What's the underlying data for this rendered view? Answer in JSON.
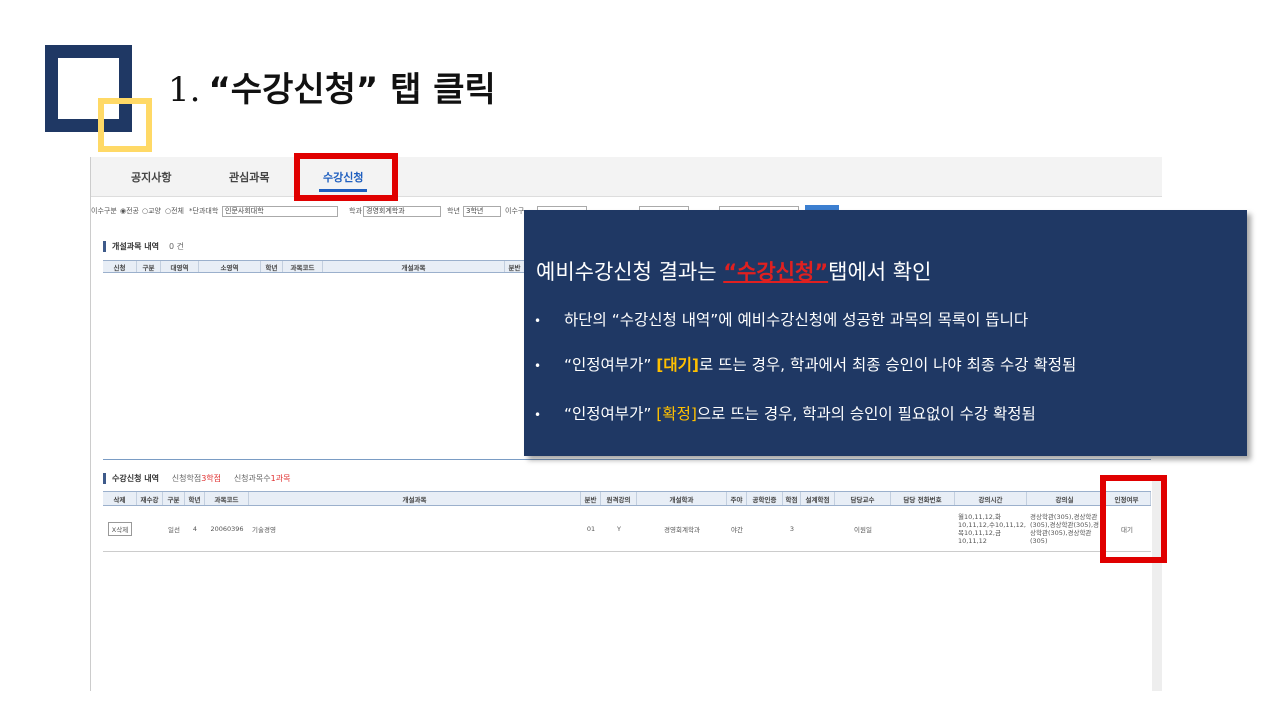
{
  "slide": {
    "title_num": "1.",
    "title_text": "“수강신청” 탭 클릭"
  },
  "tabs": [
    {
      "label": "공지사항",
      "active": false
    },
    {
      "label": "관심과목",
      "active": false
    },
    {
      "label": "수강신청",
      "active": true
    }
  ],
  "filters": {
    "type_label": "이수구분",
    "opt1": "◉전공",
    "opt2": "○교양",
    "opt3": "○전체",
    "college_label": "*단과대학",
    "college_value": "인문사회대학",
    "dept_label": "학과",
    "dept_value": "경영회계학과",
    "year_label": "학년",
    "year_value": "3학년",
    "extra_label": "이수구"
  },
  "open_courses": {
    "title": "개설과목 내역",
    "count": "0 건",
    "headers": [
      "신청",
      "구분",
      "대영역",
      "소영역",
      "학년",
      "과목코드",
      "개설과목",
      "분반"
    ]
  },
  "registration": {
    "title": "수강신청 내역",
    "credits_label": "신청학점",
    "credits_value": "3학점",
    "courses_label": "신청과목수",
    "courses_value": "1과목",
    "headers": [
      "삭제",
      "재수강",
      "구분",
      "학년",
      "과목코드",
      "개설과목",
      "분반",
      "원격강의",
      "개설학과",
      "주야",
      "공학인증",
      "학점",
      "설계학점",
      "담당교수",
      "담당 전화번호",
      "강의시간",
      "강의실",
      "인정여부"
    ],
    "row": {
      "delete": "X삭제",
      "retake": "",
      "category": "일선",
      "year": "4",
      "code": "20060396",
      "course": "기술경영",
      "section": "01",
      "remote": "Y",
      "dept": "경영회계학과",
      "daynight": "야간",
      "cert": "",
      "credits": "3",
      "design": "",
      "professor": "이원일",
      "phone": "",
      "time": "월10,11,12,화10,11,12,수10,11,12,목10,11,12,금10,11,12",
      "room": "경상학관(305),경상학관(305),경상학관(305),경상학관(305),경상학관(305)",
      "status": "대기"
    }
  },
  "callout": {
    "head_pre": "예비수강신청 결과는 ",
    "head_emph": "“수강신청”",
    "head_post": "탭에서 확인",
    "b1": "하단의 “수강신청 내역”에 예비수강신청에 성공한 과목의 목록이 뜹니다",
    "b2_pre": "“인정여부가” ",
    "b2_emph": "[대기]",
    "b2_post": "로 뜨는 경우, 학과에서 최종 승인이 나야 최종 수강 확정됨",
    "b3_pre": "“인정여부가” ",
    "b3_emph": "[확정]",
    "b3_post": "으로 뜨는 경우, 학과의 승인이 필요없이 수강 확정됨"
  },
  "colors": {
    "navy": "#1f3864",
    "gold": "#ffd966",
    "highlight": "#e00000",
    "accent_yellow": "#ffc000"
  }
}
